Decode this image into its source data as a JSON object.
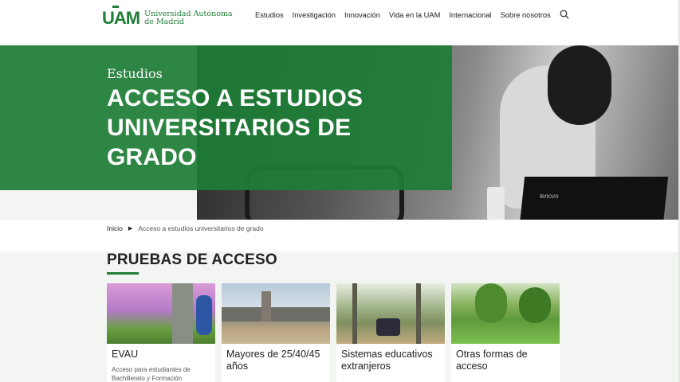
{
  "header": {
    "logo_mark": "UAM",
    "logo_line1": "Universidad Autónoma",
    "logo_line2": "de Madrid",
    "nav": [
      "Estudios",
      "Investigación",
      "Innovación",
      "Vida en la UAM",
      "Internacional",
      "Sobre nosotros"
    ],
    "search_icon": "search-icon"
  },
  "hero": {
    "subtitle": "Estudios",
    "title": "ACCESO A ESTUDIOS UNIVERSITARIOS DE GRADO",
    "laptop_label": "lenovo",
    "accent_color": "#1e7d36"
  },
  "breadcrumb": {
    "home": "Inicio",
    "current": "Acceso a estudios universitarios de grado"
  },
  "section": {
    "title": "PRUEBAS DE ACCESO",
    "cards": [
      {
        "title": "EVAU",
        "desc": "Acceso para estudiantes de Bachillerato y Formación"
      },
      {
        "title": "Mayores de 25/40/45 años",
        "desc": ""
      },
      {
        "title": "Sistemas educativos extranjeros",
        "desc": ""
      },
      {
        "title": "Otras formas de acceso",
        "desc": ""
      }
    ]
  }
}
